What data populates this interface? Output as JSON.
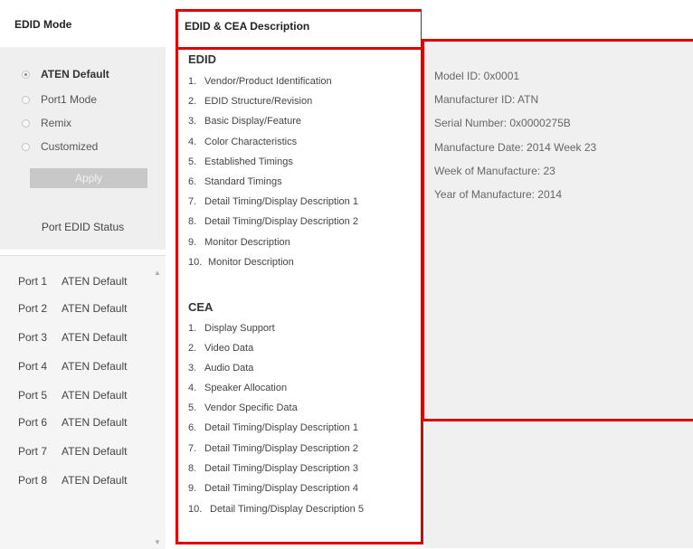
{
  "edid_mode": {
    "title": "EDID Mode",
    "options": [
      {
        "label": "ATEN Default",
        "selected": true
      },
      {
        "label": "Port1 Mode",
        "selected": false
      },
      {
        "label": "Remix",
        "selected": false
      },
      {
        "label": "Customized",
        "selected": false
      }
    ],
    "apply_label": "Apply"
  },
  "port_status": {
    "title": "Port EDID Status",
    "ports": [
      {
        "port": "Port 1",
        "status": "ATEN Default"
      },
      {
        "port": "Port 2",
        "status": "ATEN Default"
      },
      {
        "port": "Port 3",
        "status": "ATEN Default"
      },
      {
        "port": "Port 4",
        "status": "ATEN Default"
      },
      {
        "port": "Port 5",
        "status": "ATEN Default"
      },
      {
        "port": "Port 6",
        "status": "ATEN Default"
      },
      {
        "port": "Port 7",
        "status": "ATEN Default"
      },
      {
        "port": "Port 8",
        "status": "ATEN Default"
      }
    ]
  },
  "description": {
    "title": "EDID & CEA Description",
    "edid_title": "EDID",
    "edid_items": [
      {
        "num": "1.",
        "label": "Vendor/Product Identification"
      },
      {
        "num": "2.",
        "label": "EDID Structure/Revision"
      },
      {
        "num": "3.",
        "label": "Basic Display/Feature"
      },
      {
        "num": "4.",
        "label": "Color Characteristics"
      },
      {
        "num": "5.",
        "label": "Established Timings"
      },
      {
        "num": "6.",
        "label": "Standard Timings"
      },
      {
        "num": "7.",
        "label": "Detail Timing/Display Description 1"
      },
      {
        "num": "8.",
        "label": "Detail Timing/Display Description 2"
      },
      {
        "num": "9.",
        "label": "Monitor Description"
      },
      {
        "num": "10.",
        "label": "Monitor Description"
      }
    ],
    "cea_title": "CEA",
    "cea_items": [
      {
        "num": "1.",
        "label": "Display Support"
      },
      {
        "num": "2.",
        "label": "Video Data"
      },
      {
        "num": "3.",
        "label": "Audio Data"
      },
      {
        "num": "4.",
        "label": "Speaker Allocation"
      },
      {
        "num": "5.",
        "label": "Vendor Specific Data"
      },
      {
        "num": "6.",
        "label": "Detail Timing/Display Description 1"
      },
      {
        "num": "7.",
        "label": "Detail Timing/Display Description 2"
      },
      {
        "num": "8.",
        "label": "Detail Timing/Display Description 3"
      },
      {
        "num": "9.",
        "label": "Detail Timing/Display Description 4"
      },
      {
        "num": "10.",
        "label": "Detail Timing/Display Description 5"
      }
    ]
  },
  "details": {
    "lines": [
      "Model ID: 0x0001",
      "Manufacturer ID: ATN",
      "Serial Number: 0x0000275B",
      "Manufacture Date: 2014 Week 23",
      "Week of Manufacture: 23",
      "Year of Manufacture: 2014"
    ]
  },
  "colors": {
    "highlight_border": "#e00000",
    "panel_bg": "#efefef"
  }
}
